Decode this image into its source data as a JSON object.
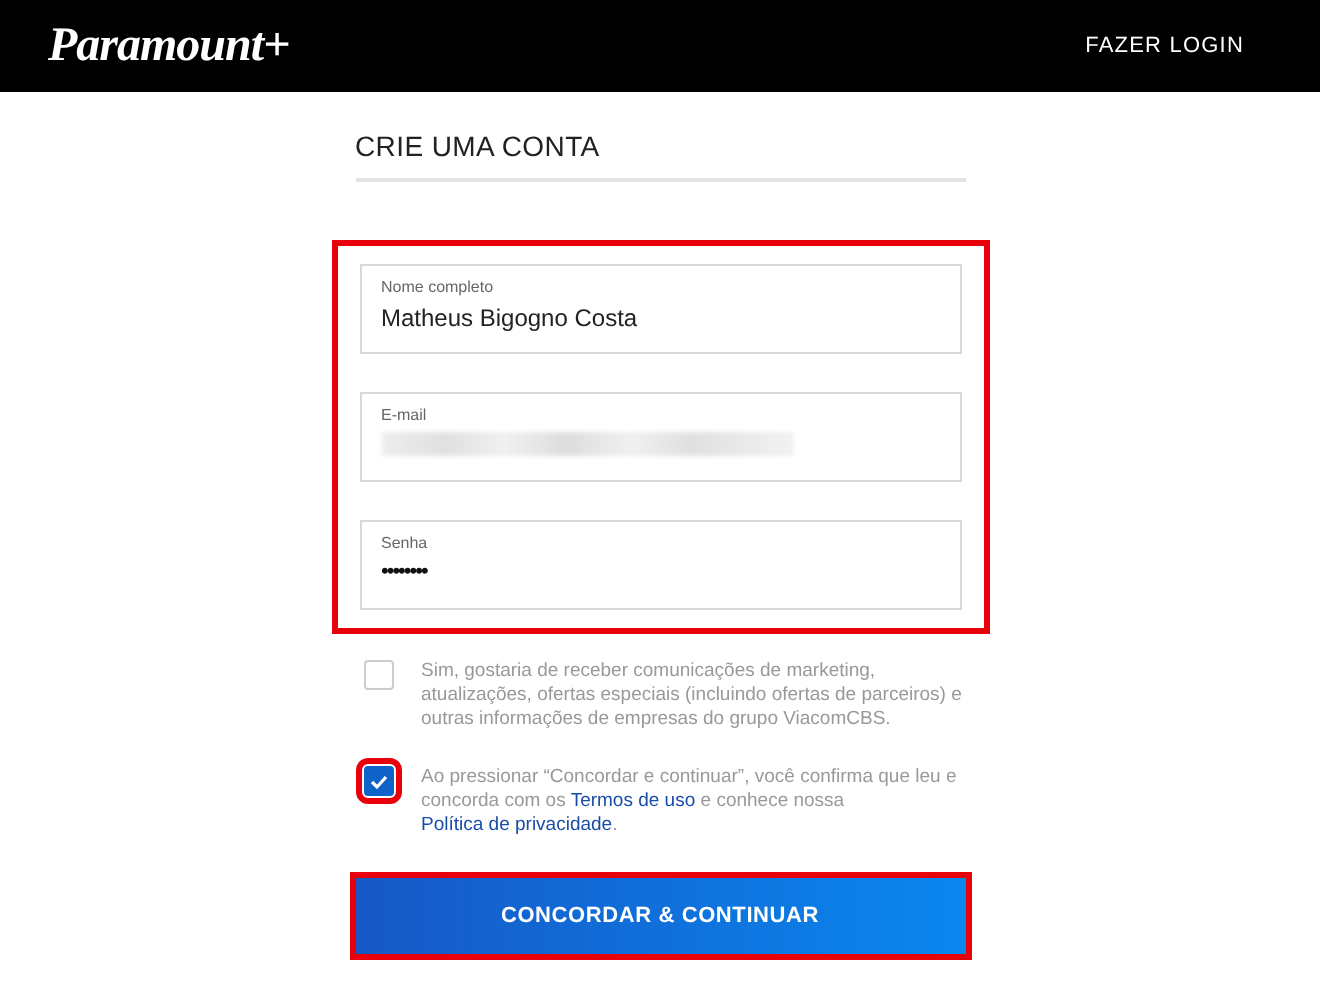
{
  "header": {
    "logo": "Paramount+",
    "login_link": "FAZER LOGIN"
  },
  "title": "CRIE UMA CONTA",
  "fields_group": {
    "highlighted": true,
    "fields": [
      {
        "label": "Nome completo",
        "value": "Matheus Bigogno Costa",
        "kind": "text",
        "redacted": false
      },
      {
        "label": "E-mail",
        "kind": "text",
        "redacted": true
      },
      {
        "label": "Senha",
        "value": "••••••••",
        "kind": "password",
        "redacted": false
      }
    ]
  },
  "consents": [
    {
      "checked": false,
      "highlighted": false,
      "segments": [
        {
          "kind": "text",
          "text": "Sim, gostaria de receber comunicações de marketing, atualizações, ofertas especiais (incluindo ofertas de parceiros) e outras informações de empresas do grupo ViacomCBS."
        }
      ]
    },
    {
      "checked": true,
      "highlighted": true,
      "segments": [
        {
          "kind": "text",
          "text": "Ao pressionar “Concordar e continuar”, você confirma que leu e concorda com os"
        },
        {
          "kind": "link",
          "text": "Termos de uso"
        },
        {
          "kind": "text",
          "text": "e conhece nossa"
        },
        {
          "kind": "link",
          "text": "Política de privacidade"
        },
        {
          "kind": "text",
          "text": "."
        }
      ]
    }
  ],
  "submit": {
    "label": "CONCORDAR & CONTINUAR",
    "highlighted": true
  }
}
